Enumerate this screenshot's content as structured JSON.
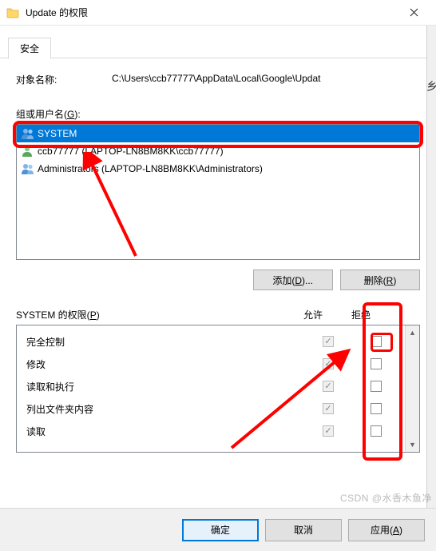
{
  "title": "Update 的权限",
  "tab": "安全",
  "object_name_label": "对象名称:",
  "object_path": "C:\\Users\\ccb77777\\AppData\\Local\\Google\\Updat",
  "groups_label": "组或用户名(G):",
  "principals": [
    {
      "name": "SYSTEM",
      "type": "group",
      "selected": true
    },
    {
      "name": "ccb77777 (LAPTOP-LN8BM8KK\\ccb77777)",
      "type": "user",
      "selected": false
    },
    {
      "name": "Administrators (LAPTOP-LN8BM8KK\\Administrators)",
      "type": "group",
      "selected": false
    }
  ],
  "add_button": "添加(D)...",
  "remove_button": "删除(R)",
  "perm_header_label": "SYSTEM 的权限(P)",
  "allow_label": "允许",
  "deny_label": "拒绝",
  "permissions": [
    {
      "name": "完全控制",
      "allow": true,
      "deny": false
    },
    {
      "name": "修改",
      "allow": true,
      "deny": false
    },
    {
      "name": "读取和执行",
      "allow": true,
      "deny": false
    },
    {
      "name": "列出文件夹内容",
      "allow": true,
      "deny": false
    },
    {
      "name": "读取",
      "allow": true,
      "deny": false
    }
  ],
  "ok_label": "确定",
  "cancel_label": "取消",
  "apply_label": "应用(A)",
  "watermark": "CSDN @水香木鱼净",
  "blur_char": "乡"
}
